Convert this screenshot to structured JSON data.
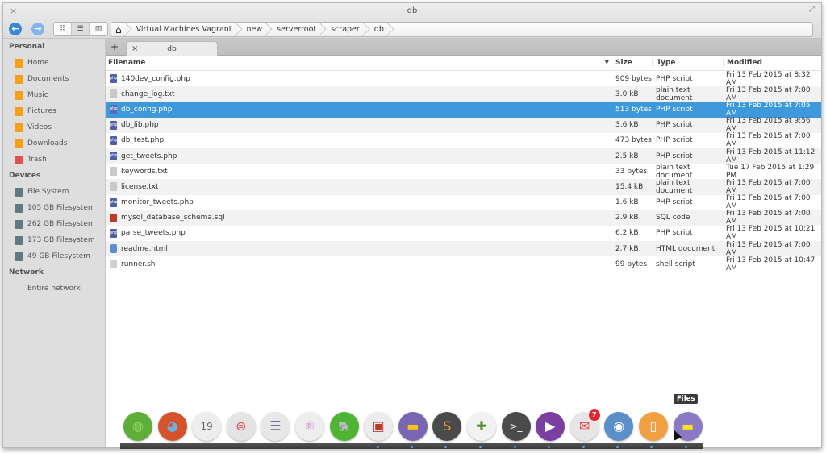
{
  "window": {
    "title": "db",
    "close_glyph": "×",
    "maximize_glyph": "⤢"
  },
  "toolbar": {
    "back_icon": "←",
    "forward_icon": "→",
    "view_modes": [
      {
        "name": "icon-view",
        "glyph": "⠿",
        "active": false
      },
      {
        "name": "list-view",
        "glyph": "☰",
        "active": true
      },
      {
        "name": "column-view",
        "glyph": "▥",
        "active": false
      }
    ],
    "breadcrumb_home_icon": "⌂",
    "breadcrumbs": [
      "Virtual Machines Vagrant",
      "new",
      "serverroot",
      "scraper",
      "db"
    ]
  },
  "sidebar": {
    "sections": [
      {
        "header": "Personal",
        "items": [
          {
            "label": "Home",
            "icon": "home-icon",
            "glyph": "⌂"
          },
          {
            "label": "Documents",
            "icon": "documents-icon",
            "glyph": "▤"
          },
          {
            "label": "Music",
            "icon": "music-icon",
            "glyph": "♫"
          },
          {
            "label": "Pictures",
            "icon": "pictures-icon",
            "glyph": "▨"
          },
          {
            "label": "Videos",
            "icon": "videos-icon",
            "glyph": "▦"
          },
          {
            "label": "Downloads",
            "icon": "downloads-icon",
            "glyph": "⤓"
          },
          {
            "label": "Trash",
            "icon": "trash-icon",
            "glyph": "▮"
          }
        ]
      },
      {
        "header": "Devices",
        "items": [
          {
            "label": "File System",
            "icon": "drive-icon",
            "glyph": "◙"
          },
          {
            "label": "105 GB Filesystem",
            "icon": "drive-icon",
            "glyph": "◙"
          },
          {
            "label": "262 GB Filesystem",
            "icon": "drive-icon",
            "glyph": "◙"
          },
          {
            "label": "173 GB Filesystem",
            "icon": "drive-icon",
            "glyph": "◙"
          },
          {
            "label": "49 GB Filesystem",
            "icon": "drive-icon",
            "glyph": "◙"
          }
        ]
      },
      {
        "header": "Network",
        "items": [
          {
            "label": "Entire network",
            "icon": "network-icon",
            "glyph": "⇅"
          }
        ]
      }
    ]
  },
  "tabs": {
    "add_glyph": "+",
    "items": [
      {
        "label": "db",
        "close_glyph": "×"
      }
    ]
  },
  "file_list": {
    "columns": {
      "name": "Filename",
      "size": "Size",
      "type": "Type",
      "modified": "Modified",
      "sort_glyph": "▼"
    },
    "rows": [
      {
        "name": "140dev_config.php",
        "size": "909 bytes",
        "type": "PHP script",
        "modified": "Fri 13 Feb 2015 at 8:32 AM",
        "kind": "php",
        "selected": false
      },
      {
        "name": "change_log.txt",
        "size": "3.0 kB",
        "type": "plain text document",
        "modified": "Fri 13 Feb 2015 at 7:00 AM",
        "kind": "txt",
        "selected": false
      },
      {
        "name": "db_config.php",
        "size": "513 bytes",
        "type": "PHP script",
        "modified": "Fri 13 Feb 2015 at 7:05 AM",
        "kind": "php",
        "selected": true
      },
      {
        "name": "db_lib.php",
        "size": "3.6 kB",
        "type": "PHP script",
        "modified": "Fri 13 Feb 2015 at 9:56 AM",
        "kind": "php",
        "selected": false
      },
      {
        "name": "db_test.php",
        "size": "473 bytes",
        "type": "PHP script",
        "modified": "Fri 13 Feb 2015 at 7:00 AM",
        "kind": "php",
        "selected": false
      },
      {
        "name": "get_tweets.php",
        "size": "2.5 kB",
        "type": "PHP script",
        "modified": "Fri 13 Feb 2015 at 11:12 AM",
        "kind": "php",
        "selected": false
      },
      {
        "name": "keywords.txt",
        "size": "33 bytes",
        "type": "plain text document",
        "modified": "Tue 17 Feb 2015 at 1:29 PM",
        "kind": "txt",
        "selected": false
      },
      {
        "name": "license.txt",
        "size": "15.4 kB",
        "type": "plain text document",
        "modified": "Fri 13 Feb 2015 at 7:00 AM",
        "kind": "txt",
        "selected": false
      },
      {
        "name": "monitor_tweets.php",
        "size": "1.6 kB",
        "type": "PHP script",
        "modified": "Fri 13 Feb 2015 at 7:00 AM",
        "kind": "php",
        "selected": false
      },
      {
        "name": "mysql_database_schema.sql",
        "size": "2.9 kB",
        "type": "SQL code",
        "modified": "Fri 13 Feb 2015 at 7:00 AM",
        "kind": "sql",
        "selected": false
      },
      {
        "name": "parse_tweets.php",
        "size": "6.2 kB",
        "type": "PHP script",
        "modified": "Fri 13 Feb 2015 at 10:21 AM",
        "kind": "php",
        "selected": false
      },
      {
        "name": "readme.html",
        "size": "2.7 kB",
        "type": "HTML document",
        "modified": "Fri 13 Feb 2015 at 7:00 AM",
        "kind": "html",
        "selected": false
      },
      {
        "name": "runner.sh",
        "size": "99 bytes",
        "type": "shell script",
        "modified": "Fri 13 Feb 2015 at 10:47 AM",
        "kind": "sh",
        "selected": false
      }
    ]
  },
  "dock": {
    "tooltip": "Files",
    "apps": [
      {
        "name": "globe-app",
        "glyph": "◍",
        "color": "#5fae3a",
        "fg": "#8fd36a"
      },
      {
        "name": "firefox",
        "glyph": "◕",
        "color": "#d4532a",
        "fg": "#6ab0e8"
      },
      {
        "name": "calendar",
        "glyph": "19",
        "color": "#ededed",
        "fg": "#666"
      },
      {
        "name": "switchboard-settings",
        "glyph": "⊜",
        "color": "#e4e4e4",
        "fg": "#e34b4b"
      },
      {
        "name": "eclipse",
        "glyph": "☰",
        "color": "#e8e8e8",
        "fg": "#2b2c6b"
      },
      {
        "name": "atom",
        "glyph": "⚛",
        "color": "#eeeeee",
        "fg": "#c86bbf"
      },
      {
        "name": "evernote",
        "glyph": "🐘",
        "color": "#4fb433",
        "fg": "#222"
      },
      {
        "name": "remote-desktop",
        "glyph": "▣",
        "color": "#ececec",
        "fg": "#c0392b"
      },
      {
        "name": "files-purple",
        "glyph": "▬",
        "color": "#7a66b0",
        "fg": "#f5c518"
      },
      {
        "name": "sublime-text",
        "glyph": "S",
        "color": "#4a4a4a",
        "fg": "#f39c25"
      },
      {
        "name": "clock-install",
        "glyph": "✚",
        "color": "#f2f2f2",
        "fg": "#5a8e2e"
      },
      {
        "name": "terminal",
        "glyph": ">_",
        "color": "#4b4b4b",
        "fg": "#fff"
      },
      {
        "name": "media-player",
        "glyph": "▶",
        "color": "#7b3fa0",
        "fg": "#fff"
      },
      {
        "name": "mail",
        "glyph": "✉",
        "color": "#e6e6e6",
        "fg": "#e04545",
        "badge": "7"
      },
      {
        "name": "chromium",
        "glyph": "◉",
        "color": "#5b8fc9",
        "fg": "#fff"
      },
      {
        "name": "archive-manager",
        "glyph": "▯",
        "color": "#f0a040",
        "fg": "#fff"
      },
      {
        "name": "files",
        "glyph": "▬",
        "color": "#8c79c4",
        "fg": "#f7e11a"
      }
    ]
  }
}
